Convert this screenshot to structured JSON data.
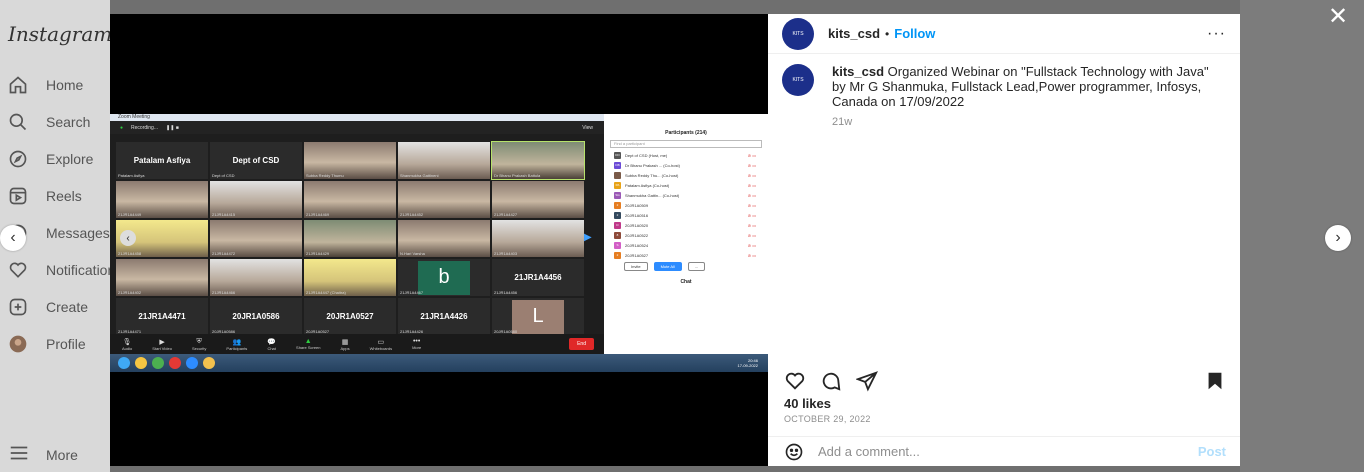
{
  "app": {
    "logo": "Instagram"
  },
  "sidebar": {
    "items": [
      {
        "label": "Home",
        "icon": "home-icon"
      },
      {
        "label": "Search",
        "icon": "search-icon"
      },
      {
        "label": "Explore",
        "icon": "explore-icon"
      },
      {
        "label": "Reels",
        "icon": "reels-icon"
      },
      {
        "label": "Messages",
        "icon": "messages-icon"
      },
      {
        "label": "Notifications",
        "icon": "heart-icon"
      },
      {
        "label": "Create",
        "icon": "create-icon"
      },
      {
        "label": "Profile",
        "icon": "profile-avatar"
      }
    ],
    "more": "More"
  },
  "modal": {
    "prev": "‹",
    "next": "›",
    "close": "✕"
  },
  "zoom": {
    "window_title": "Zoom Meeting",
    "recording": "Recording...",
    "view": "View",
    "tiles": [
      {
        "name": "Patalam Asfiya",
        "caption": "Patalam Asfiya",
        "kind": "name"
      },
      {
        "name": "Dept of CSD",
        "caption": "Dept of CSD",
        "kind": "name"
      },
      {
        "name": "",
        "caption": "Subba Reddy Thumu",
        "kind": "photo"
      },
      {
        "name": "",
        "caption": "Shanmukha Gattineni",
        "kind": "photo w"
      },
      {
        "name": "",
        "caption": "Dr Bhanu Prakash Battula",
        "kind": "photo g active"
      },
      {
        "name": "",
        "caption": "21JR1A4449",
        "kind": "photo"
      },
      {
        "name": "",
        "caption": "21JR1A4415",
        "kind": "photo w"
      },
      {
        "name": "",
        "caption": "21JR1A4469",
        "kind": "photo"
      },
      {
        "name": "",
        "caption": "21JR1A4452",
        "kind": "photo"
      },
      {
        "name": "",
        "caption": "21JR1A4427",
        "kind": "photo"
      },
      {
        "name": "",
        "caption": "21JR1A4458",
        "kind": "photo y"
      },
      {
        "name": "",
        "caption": "21JR1A4472",
        "kind": "photo"
      },
      {
        "name": "",
        "caption": "21JR1A4429",
        "kind": "photo g"
      },
      {
        "name": "",
        "caption": "N.Hari Varsha",
        "kind": "photo"
      },
      {
        "name": "",
        "caption": "21JR1A4403",
        "kind": "photo w"
      },
      {
        "name": "",
        "caption": "21JR1A4402",
        "kind": "photo"
      },
      {
        "name": "",
        "caption": "21JR1A4466",
        "kind": "photo w"
      },
      {
        "name": "",
        "caption": "21JR1A4447 (Chaitra)",
        "kind": "photo y"
      },
      {
        "name": "b",
        "caption": "21JR1A4467",
        "kind": "bsq"
      },
      {
        "name": "21JR1A4456",
        "caption": "21JR1A4456",
        "kind": "name"
      },
      {
        "name": "21JR1A4471",
        "caption": "21JR1A4471",
        "kind": "name"
      },
      {
        "name": "20JR1A0586",
        "caption": "20JR1A0586",
        "kind": "name"
      },
      {
        "name": "20JR1A0527",
        "caption": "20JR1A0527",
        "kind": "name"
      },
      {
        "name": "21JR1A4426",
        "caption": "21JR1A4426",
        "kind": "name"
      },
      {
        "name": "L",
        "caption": "20JR1A0580",
        "kind": "lsq"
      }
    ],
    "participants": {
      "title": "Participants (214)",
      "find_placeholder": "Find a participant",
      "rows": [
        {
          "initials": "DO",
          "name": "Dept of CSD (Host, me)",
          "color": "#555555"
        },
        {
          "initials": "DB",
          "name": "Dr Bhanu Prakash ... (Co-host)",
          "color": "#6b4bd6"
        },
        {
          "initials": "",
          "name": "Subba Reddy Thu... (Co-host)",
          "color": "#7a5a48"
        },
        {
          "initials": "PA",
          "name": "Patalam Asfiya (Co-host)",
          "color": "#e8a317"
        },
        {
          "initials": "SG",
          "name": "Shanmukha Gattin... (Co-host)",
          "color": "#9b59b6"
        },
        {
          "initials": "2",
          "name": "20JR1A0509",
          "color": "#e67e22"
        },
        {
          "initials": "2",
          "name": "20JR1A0516",
          "color": "#34495e"
        },
        {
          "initials": "D",
          "name": "20JR1A0520",
          "color": "#c0398a"
        },
        {
          "initials": "8",
          "name": "20JR1A0522",
          "color": "#8e4a3a"
        },
        {
          "initials": "S",
          "name": "20JR1A0524",
          "color": "#d35fc6"
        },
        {
          "initials": "2",
          "name": "20JR1A0527",
          "color": "#e67e22"
        }
      ],
      "invite": "Invite",
      "mute_all": "Mute All",
      "more": "...",
      "chat": "Chat"
    },
    "toolbar": [
      {
        "label": "Audio",
        "icon": "🎙"
      },
      {
        "label": "Start Video",
        "icon": "▶"
      },
      {
        "label": "Security",
        "icon": "⛨"
      },
      {
        "label": "Participants",
        "icon": "👥"
      },
      {
        "label": "Chat",
        "icon": "💬"
      },
      {
        "label": "Share Screen",
        "icon": "▲"
      },
      {
        "label": "Apps",
        "icon": "▦"
      },
      {
        "label": "Whiteboards",
        "icon": "▭"
      },
      {
        "label": "More",
        "icon": "•••"
      }
    ],
    "end": "End",
    "clock_time": "20:46",
    "clock_date": "17-09-2022"
  },
  "post": {
    "username": "kits_csd",
    "follow": "Follow",
    "avatar_text": "KITS",
    "caption_user": "kits_csd",
    "caption_text": " Organized Webinar on \"Fullstack Technology with Java\" by Mr G Shanmuka, Fullstack Lead,Power programmer, Infosys, Canada on 17/09/2022",
    "caption_age": "21w",
    "likes": "40 likes",
    "date": "OCTOBER 29, 2022",
    "comment_placeholder": "Add a comment...",
    "post_button": "Post"
  }
}
